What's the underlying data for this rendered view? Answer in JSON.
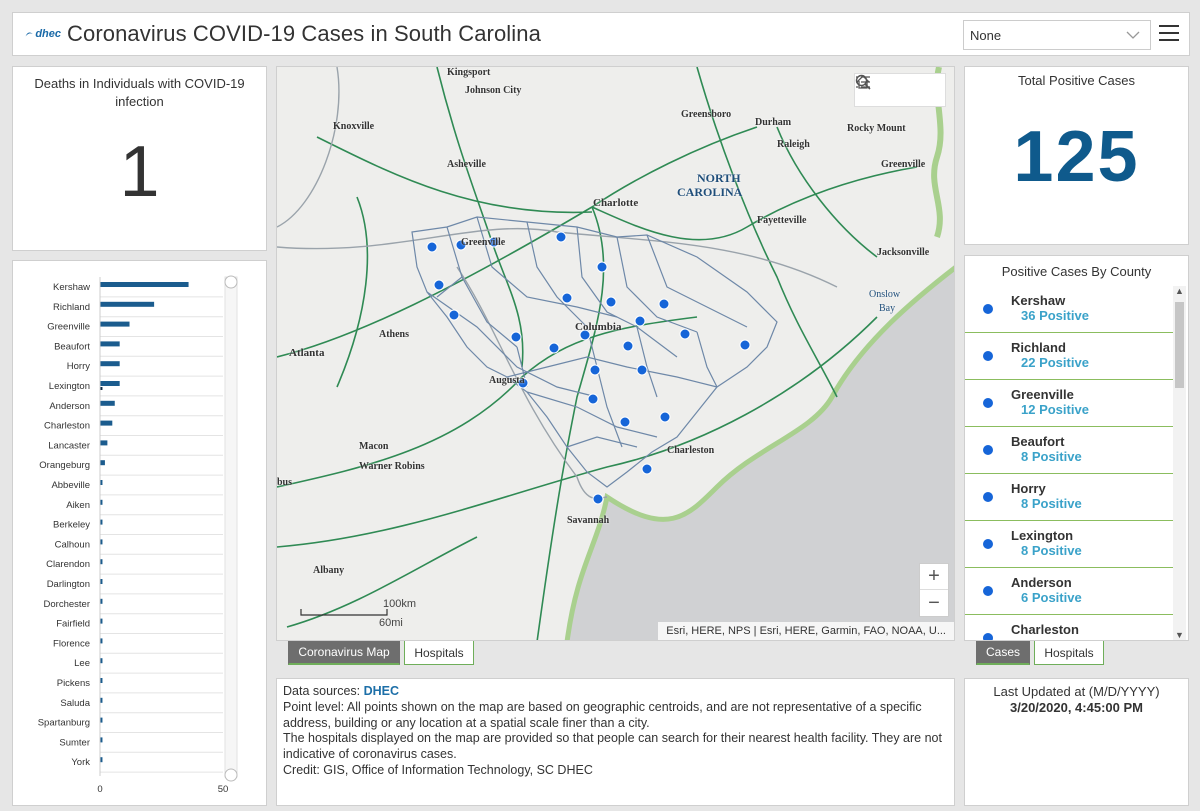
{
  "header": {
    "logo_text": "dhec",
    "title": "Coronavirus COVID-19 Cases in South Carolina",
    "selector_value": "None"
  },
  "deaths": {
    "label": "Deaths in Individuals with COVID-19 infection",
    "value": "1"
  },
  "total": {
    "label": "Total Positive Cases",
    "value": "125"
  },
  "chart_data": {
    "type": "bar",
    "orientation": "horizontal",
    "categories": [
      "Kershaw",
      "Richland",
      "Greenville",
      "Beaufort",
      "Horry",
      "Lexington",
      "Anderson",
      "Charleston",
      "Lancaster",
      "Orangeburg",
      "Abbeville",
      "Aiken",
      "Berkeley",
      "Calhoun",
      "Clarendon",
      "Darlington",
      "Dorchester",
      "Fairfield",
      "Florence",
      "Lee",
      "Pickens",
      "Saluda",
      "Spartanburg",
      "Sumter",
      "York"
    ],
    "series": [
      {
        "values": [
          36,
          22,
          12,
          8,
          8,
          8,
          6,
          5,
          3,
          2,
          1,
          1,
          1,
          1,
          1,
          1,
          1,
          1,
          1,
          1,
          1,
          1,
          1,
          1,
          1
        ]
      },
      {
        "values": [
          0,
          0,
          0,
          0,
          0,
          1,
          0,
          0,
          0,
          0,
          0,
          0,
          0,
          0,
          0,
          0,
          0,
          0,
          0,
          0,
          0,
          0,
          0,
          0,
          0
        ]
      }
    ],
    "xticks": [
      "0",
      "50"
    ],
    "xlim": [
      0,
      50
    ],
    "colors": [
      "#1b5c8e",
      "#102a44"
    ]
  },
  "map": {
    "tools": [
      "search-icon",
      "home-icon",
      "legend-icon"
    ],
    "places": [
      {
        "name": "Kingsport"
      },
      {
        "name": "Johnson City"
      },
      {
        "name": "Knoxville"
      },
      {
        "name": "Greensboro"
      },
      {
        "name": "Durham"
      },
      {
        "name": "Rocky Mount"
      },
      {
        "name": "Raleigh"
      },
      {
        "name": "Greenville"
      },
      {
        "name": "Asheville"
      },
      {
        "name": "NORTH"
      },
      {
        "name": "CAROLINA"
      },
      {
        "name": "Charlotte"
      },
      {
        "name": "Fayetteville"
      },
      {
        "name": "Greenville"
      },
      {
        "name": "Jacksonville"
      },
      {
        "name": "Onslow"
      },
      {
        "name": "Bay"
      },
      {
        "name": "Athens"
      },
      {
        "name": "Atlanta"
      },
      {
        "name": "Columbia"
      },
      {
        "name": "Augusta"
      },
      {
        "name": "Macon"
      },
      {
        "name": "Warner Robins"
      },
      {
        "name": "Charleston"
      },
      {
        "name": "bus"
      },
      {
        "name": "Savannah"
      },
      {
        "name": "Albany"
      }
    ],
    "scale_km": "100km",
    "scale_mi": "60mi",
    "zoom_in": "+",
    "zoom_out": "−",
    "attribution": "Esri, HERE, NPS | Esri, HERE, Garmin, FAO, NOAA, U..."
  },
  "map_tabs": [
    "Coronavirus Map",
    "Hospitals"
  ],
  "county_panel": {
    "title": "Positive Cases By County",
    "items": [
      {
        "name": "Kershaw",
        "count": "36 Positive"
      },
      {
        "name": "Richland",
        "count": "22 Positive"
      },
      {
        "name": "Greenville",
        "count": "12 Positive"
      },
      {
        "name": "Beaufort",
        "count": "8 Positive"
      },
      {
        "name": "Horry",
        "count": "8 Positive"
      },
      {
        "name": "Lexington",
        "count": "8 Positive"
      },
      {
        "name": "Anderson",
        "count": "6 Positive"
      },
      {
        "name": "Charleston",
        "count": ""
      }
    ]
  },
  "county_tabs": [
    "Cases",
    "Hospitals"
  ],
  "sources": {
    "prefix": "Data sources: ",
    "link": "DHEC",
    "line1": "Point level: All points shown on the map are based on geographic centroids, and are not representative of a specific address, building or any location at a spatial scale finer than a city.",
    "line2": "The hospitals displayed on the map are provided so that people can search for their nearest health facility. They are not indicative of coronavirus cases.",
    "line3": "Credit: GIS, Office of Information Technology, SC DHEC"
  },
  "updated": {
    "label": "Last Updated at (M/D/YYYY)",
    "value": "3/20/2020, 4:45:00 PM"
  }
}
